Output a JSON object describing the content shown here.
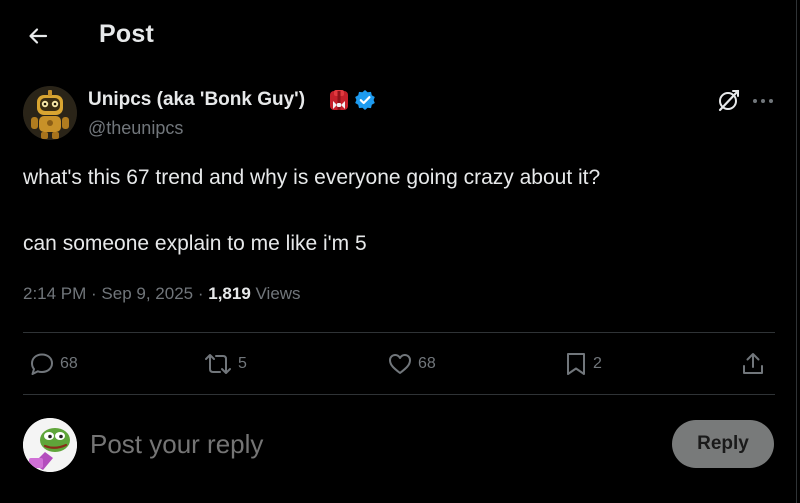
{
  "header": {
    "title": "Post"
  },
  "author": {
    "name": "Unipcs (aka 'Bonk Guy')",
    "handle": "@theunipcs",
    "verified_color": "#1d9bf0"
  },
  "post": {
    "line1": "what's this 67 trend and why is everyone going crazy about it?",
    "line2": "can someone explain to me like i'm 5"
  },
  "meta": {
    "time": "2:14 PM",
    "sep1": " · ",
    "date": "Sep 9, 2025",
    "sep2": " · ",
    "views_count": "1,819",
    "views_label": " Views"
  },
  "actions": {
    "replies": "68",
    "reposts": "5",
    "likes": "68",
    "bookmarks": "2"
  },
  "reply": {
    "placeholder": "Post your reply",
    "button": "Reply"
  },
  "icons": {
    "back": "arrow-left-icon",
    "grok": "grok-icon",
    "more": "more-icon",
    "reply": "comment-icon",
    "repost": "repost-icon",
    "like": "heart-icon",
    "bookmark": "bookmark-icon",
    "share": "share-icon"
  }
}
